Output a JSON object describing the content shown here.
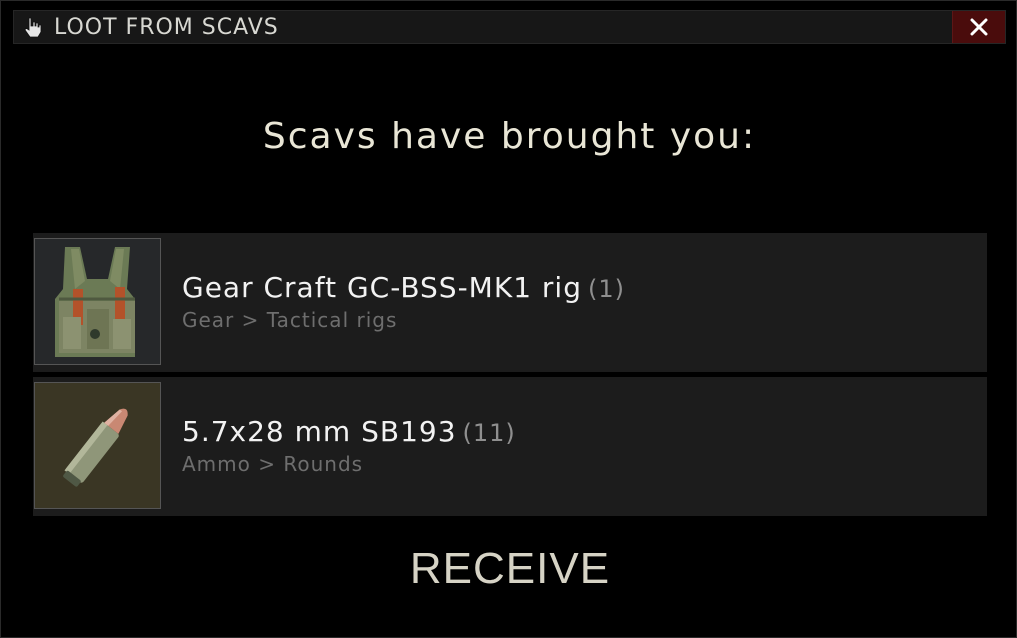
{
  "window": {
    "title": "LOOT FROM SCAVS",
    "title_icon": "hand-pointer-icon",
    "close_icon": "close-icon"
  },
  "heading": "Scavs have brought you:",
  "items": [
    {
      "name": "Gear Craft GC-BSS-MK1 rig",
      "quantity": "(1)",
      "category": "Gear > Tactical rigs",
      "icon": "tactical-rig-icon"
    },
    {
      "name": "5.7x28 mm SB193",
      "quantity": "(11)",
      "category": "Ammo > Rounds",
      "icon": "ammo-round-icon"
    }
  ],
  "receive_label": "RECEIVE",
  "colors": {
    "close_bg": "#4a0c0c",
    "text_primary": "#f2f2f2",
    "text_muted": "#6e6e6e"
  }
}
